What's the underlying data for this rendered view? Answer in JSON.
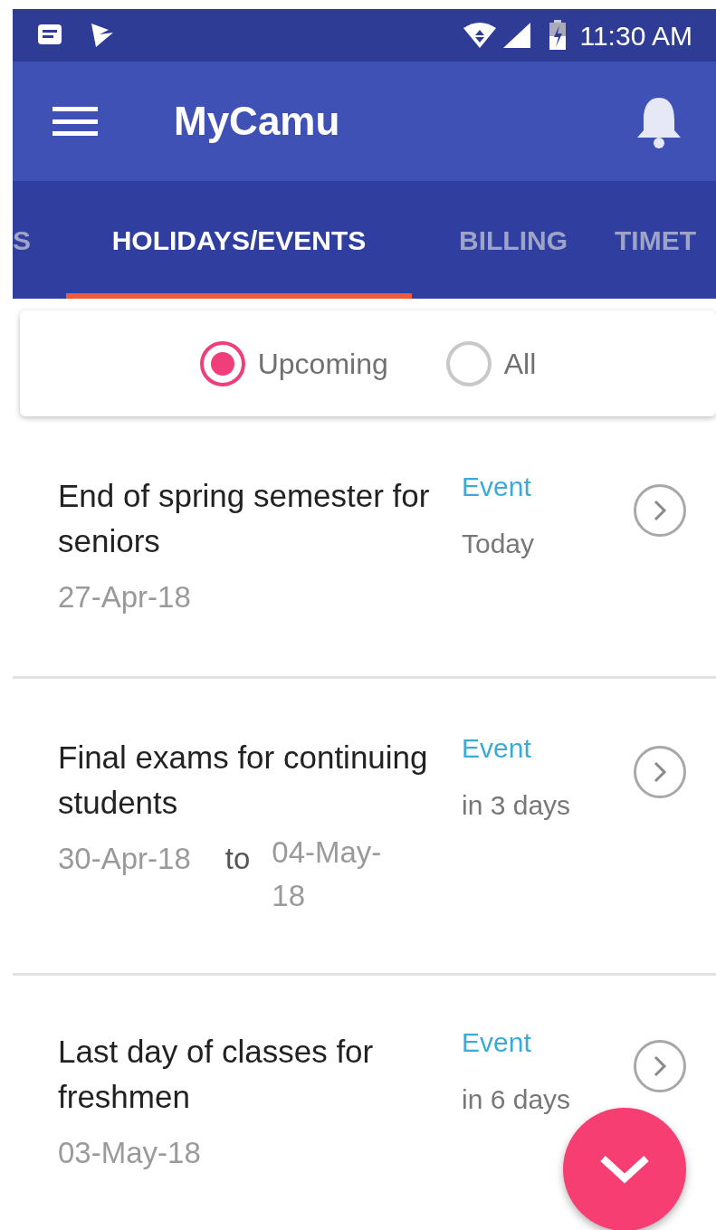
{
  "status_bar": {
    "time": "11:30 AM"
  },
  "app_bar": {
    "title": "MyCamu"
  },
  "tabs": [
    {
      "label": "S",
      "selected": false
    },
    {
      "label": "HOLIDAYS/EVENTS",
      "selected": true
    },
    {
      "label": "BILLING",
      "selected": false
    },
    {
      "label": "TIMET",
      "selected": false
    }
  ],
  "filter": [
    {
      "label": "Upcoming",
      "selected": true
    },
    {
      "label": "All",
      "selected": false
    }
  ],
  "events": [
    {
      "title": "End of spring semester for seniors",
      "date": "27-Apr-18",
      "type": "Event",
      "when": "Today"
    },
    {
      "title": "Final exams for continuing students",
      "date": "30-Apr-18",
      "to": "to",
      "date_end": "04-May-18",
      "type": "Event",
      "when": "in 3 days"
    },
    {
      "title": "Last day of classes for freshmen",
      "date": "03-May-18",
      "type": "Event",
      "when": "in 6 days"
    }
  ]
}
